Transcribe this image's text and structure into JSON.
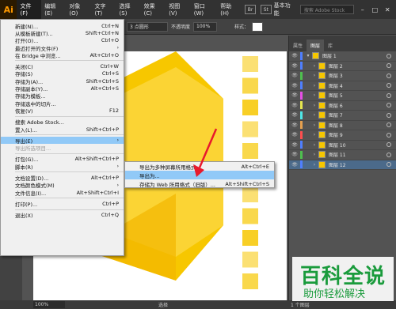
{
  "app": {
    "logo": "Ai"
  },
  "menubar": {
    "items": [
      "文件(F)",
      "编辑(E)",
      "对象(O)",
      "文字(T)",
      "选择(S)",
      "效果(C)",
      "视图(V)",
      "窗口(W)",
      "帮助(H)"
    ],
    "icon1": "Br",
    "icon2": "St",
    "workspace": "基本功能",
    "search_placeholder": "搜索 Adobe Stock"
  },
  "controlbar": {
    "stroke_style": "3 点圆形",
    "opacity_label": "不透明度",
    "opacity_value": "100%",
    "style_label": "样式："
  },
  "file_menu": {
    "items": [
      {
        "label": "新建(N)...",
        "shortcut": "Ctrl+N"
      },
      {
        "label": "从模板新建(T)...",
        "shortcut": "Shift+Ctrl+N"
      },
      {
        "label": "打开(O)...",
        "shortcut": "Ctrl+O"
      },
      {
        "label": "最近打开的文件(F)",
        "shortcut": "",
        "submenu": true
      },
      {
        "label": "在 Bridge 中浏览...",
        "shortcut": "Alt+Ctrl+O"
      },
      {
        "sep": true
      },
      {
        "label": "关闭(C)",
        "shortcut": "Ctrl+W"
      },
      {
        "label": "存储(S)",
        "shortcut": "Ctrl+S"
      },
      {
        "label": "存储为(A)...",
        "shortcut": "Shift+Ctrl+S"
      },
      {
        "label": "存储副本(Y)...",
        "shortcut": "Alt+Ctrl+S"
      },
      {
        "label": "存储为模板...",
        "shortcut": ""
      },
      {
        "label": "存储选中的切片...",
        "shortcut": ""
      },
      {
        "label": "恢复(V)",
        "shortcut": "F12"
      },
      {
        "sep": true
      },
      {
        "label": "搜索 Adobe Stock...",
        "shortcut": ""
      },
      {
        "label": "置入(L)...",
        "shortcut": "Shift+Ctrl+P"
      },
      {
        "sep": true
      },
      {
        "label": "导出(E)",
        "shortcut": "",
        "submenu": true,
        "highlight": true
      },
      {
        "label": "导出所选项目...",
        "shortcut": "",
        "disabled": true
      },
      {
        "sep": true
      },
      {
        "label": "打包(G)...",
        "shortcut": "Alt+Shift+Ctrl+P"
      },
      {
        "label": "脚本(R)",
        "shortcut": "",
        "submenu": true
      },
      {
        "sep": true
      },
      {
        "label": "文档设置(D)...",
        "shortcut": "Alt+Ctrl+P"
      },
      {
        "label": "文档颜色模式(M)",
        "shortcut": "",
        "submenu": true
      },
      {
        "label": "文件信息(I)...",
        "shortcut": "Alt+Shift+Ctrl+I"
      },
      {
        "sep": true
      },
      {
        "label": "打印(P)...",
        "shortcut": "Ctrl+P"
      },
      {
        "sep": true
      },
      {
        "label": "退出(X)",
        "shortcut": "Ctrl+Q"
      }
    ]
  },
  "export_submenu": {
    "items": [
      {
        "label": "导出为多种屏幕所用格式...",
        "shortcut": "Alt+Ctrl+E"
      },
      {
        "label": "导出为...",
        "shortcut": "",
        "highlight": true
      },
      {
        "label": "存储为 Web 所用格式（旧版）...",
        "shortcut": "Alt+Shift+Ctrl+S"
      }
    ]
  },
  "layers_panel": {
    "tabs": [
      "属性",
      "图层",
      "库"
    ],
    "parent_layer": "图层 1",
    "layers": [
      {
        "name": "图层 2",
        "color": "#4f7fff"
      },
      {
        "name": "图层 3",
        "color": "#4fc04f"
      },
      {
        "name": "图层 4",
        "color": "#4f7fff"
      },
      {
        "name": "图层 5",
        "color": "#e64fe6"
      },
      {
        "name": "图层 6",
        "color": "#e6e64f"
      },
      {
        "name": "图层 7",
        "color": "#4fe6e6"
      },
      {
        "name": "图层 8",
        "color": "#e6a04f"
      },
      {
        "name": "图层 9",
        "color": "#ff4f4f"
      },
      {
        "name": "图层 10",
        "color": "#4f7fff"
      },
      {
        "name": "图层 11",
        "color": "#4fc04f"
      },
      {
        "name": "图层 12",
        "color": "#4f7fff"
      }
    ],
    "footer": "1 个图层"
  },
  "statusbar": {
    "zoom": "100%",
    "mode": "选择"
  },
  "watermark": {
    "title": "百科全说",
    "subtitle": "助你轻松解决"
  },
  "colors": {
    "accent_yellow": "#f7c700",
    "menu_highlight": "#91c9f7",
    "watermark_green": "#1a9b3c"
  }
}
